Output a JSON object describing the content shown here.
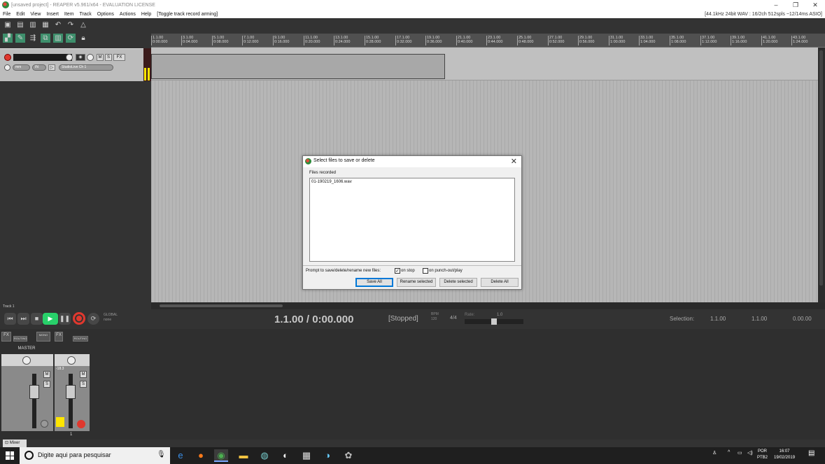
{
  "window": {
    "title": "[unsaved project] - REAPER v5.961/x64 - EVALUATION LICENSE",
    "minimize": "–",
    "maximize": "❐",
    "close": "✕"
  },
  "menu": {
    "items": [
      "File",
      "Edit",
      "View",
      "Insert",
      "Item",
      "Track",
      "Options",
      "Actions",
      "Help",
      "[Toggle track record arming]"
    ],
    "status": "[44.1kHz 24bit WAV : 16/2ch 512spls ~12/14ms ASIO]"
  },
  "ruler": {
    "ticks": [
      {
        "bar": "1.1.00",
        "time": "0:00.000"
      },
      {
        "bar": "3.1.00",
        "time": "0:04.000"
      },
      {
        "bar": "5.1.00",
        "time": "0:08.000"
      },
      {
        "bar": "7.1.00",
        "time": "0:12.000"
      },
      {
        "bar": "9.1.00",
        "time": "0:16.000"
      },
      {
        "bar": "11.1.00",
        "time": "0:20.000"
      },
      {
        "bar": "13.1.00",
        "time": "0:24.000"
      },
      {
        "bar": "15.1.00",
        "time": "0:28.000"
      },
      {
        "bar": "17.1.00",
        "time": "0:32.000"
      },
      {
        "bar": "19.1.00",
        "time": "0:36.000"
      },
      {
        "bar": "21.1.00",
        "time": "0:40.000"
      },
      {
        "bar": "23.1.00",
        "time": "0:44.000"
      },
      {
        "bar": "25.1.00",
        "time": "0:48.000"
      },
      {
        "bar": "27.1.00",
        "time": "0:52.000"
      },
      {
        "bar": "29.1.00",
        "time": "0:56.000"
      },
      {
        "bar": "31.1.00",
        "time": "1:00.000"
      },
      {
        "bar": "33.1.00",
        "time": "1:04.000"
      },
      {
        "bar": "35.1.00",
        "time": "1:08.000"
      },
      {
        "bar": "37.1.00",
        "time": "1:12.000"
      },
      {
        "bar": "39.1.00",
        "time": "1:16.000"
      },
      {
        "bar": "41.1.00",
        "time": "1:20.000"
      },
      {
        "bar": "43.1.00",
        "time": "1:24.000"
      }
    ]
  },
  "track": {
    "input_mode": "IN",
    "mono_label": "mm",
    "input_name": "StudioLive Ch 1",
    "m": "M",
    "s": "S",
    "fx": "FX"
  },
  "transport": {
    "track_label": "Track 1",
    "global_label": "GLOBAL",
    "global_sub": "none",
    "timecode": "1.1.00 / 0:00.000",
    "status": "[Stopped]",
    "bpm_label": "BPM",
    "bpm": "120",
    "time_sig": "4/4",
    "rate_label": "Rate:",
    "rate": "1.0",
    "selection_label": "Selection:",
    "sel_start": "1.1.00",
    "sel_end": "1.1.00",
    "sel_len": "0.00.00"
  },
  "mixer": {
    "master_label": "MASTER",
    "routing_label": "ROUTING",
    "mono_label": "MONO",
    "fx_label": "FX",
    "m": "M",
    "s": "S",
    "track_number": "1",
    "track_db": "-18.3",
    "tab_label": "Mixer"
  },
  "dialog": {
    "title": "Select files to save or delete",
    "group_label": "Files recorded",
    "files": [
      "01-190219_1606.wav"
    ],
    "prompt_label": "Prompt to save/delete/rename new files:",
    "on_stop_label": "on stop",
    "on_stop_checked": true,
    "on_punch_label": "on punch-out/play",
    "on_punch_checked": false,
    "save_all": "Save All",
    "rename_selected": "Rename selected",
    "delete_selected": "Delete selected",
    "delete_all": "Delete All"
  },
  "taskbar": {
    "search_placeholder": "Digite aqui para pesquisar",
    "lang": "POR",
    "lang_sub": "PTB2",
    "time": "16:07",
    "date": "19/02/2019"
  }
}
